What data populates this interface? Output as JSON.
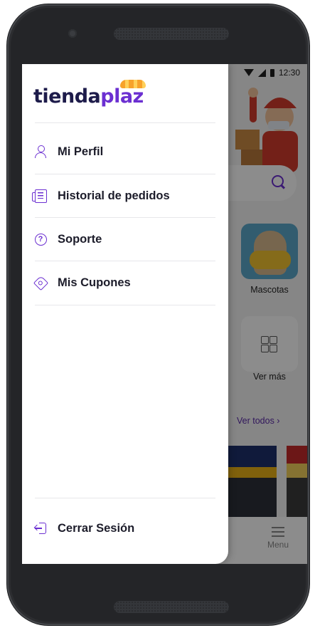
{
  "status_bar": {
    "time": "12:30"
  },
  "brand": {
    "part1": "tienda",
    "part2": "plaz"
  },
  "menu": {
    "items": [
      {
        "label": "Mi Perfil",
        "icon": "user-icon"
      },
      {
        "label": "Historial de pedidos",
        "icon": "order-history-icon"
      },
      {
        "label": "Soporte",
        "icon": "help-icon"
      },
      {
        "label": "Mis Cupones",
        "icon": "coupon-icon"
      }
    ],
    "logout_label": "Cerrar Sesión"
  },
  "background": {
    "category_label": "Mascotas",
    "more_label": "Ver más",
    "see_all": "Ver todos",
    "nav_menu_label": "Menu"
  },
  "colors": {
    "accent": "#6b2fd1",
    "text_dark": "#1c1c2a",
    "logo_dark": "#1d1b4a"
  }
}
